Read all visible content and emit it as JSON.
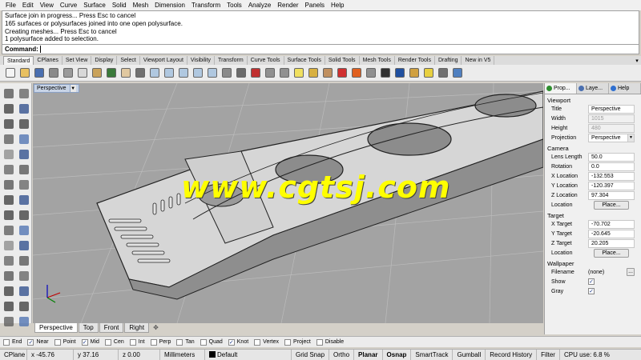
{
  "menu": [
    "File",
    "Edit",
    "View",
    "Curve",
    "Surface",
    "Solid",
    "Mesh",
    "Dimension",
    "Transform",
    "Tools",
    "Analyze",
    "Render",
    "Panels",
    "Help"
  ],
  "history": [
    "Surface join in progress... Press Esc to cancel",
    "165 surfaces or polysurfaces joined into one open polysurface.",
    "Creating meshes... Press Esc to cancel",
    "1 polysurface added to selection."
  ],
  "command": {
    "label": "Command:"
  },
  "toolbar_tabs": [
    "Standard",
    "CPlanes",
    "Set View",
    "Display",
    "Select",
    "Viewport Layout",
    "Visibility",
    "Transform",
    "Curve Tools",
    "Surface Tools",
    "Solid Tools",
    "Mesh Tools",
    "Render Tools",
    "Drafting",
    "New in V5"
  ],
  "toolbar_icons": [
    {
      "name": "new-file-icon",
      "color": "#f4f4f4"
    },
    {
      "name": "open-folder-icon",
      "color": "#e8c060"
    },
    {
      "name": "save-icon",
      "color": "#4a6fb0"
    },
    {
      "name": "print-icon",
      "color": "#8a8a8a"
    },
    {
      "name": "cut-icon",
      "color": "#9a9a9a"
    },
    {
      "name": "copy-icon",
      "color": "#d8d8d8"
    },
    {
      "name": "paste-icon",
      "color": "#c9a25a"
    },
    {
      "name": "undo-icon",
      "color": "#3a7a3a"
    },
    {
      "name": "pan-hand-icon",
      "color": "#e0c8a0"
    },
    {
      "name": "rotate-view-icon",
      "color": "#707070"
    },
    {
      "name": "zoom-icon",
      "color": "#b0c8e0"
    },
    {
      "name": "zoom-window-icon",
      "color": "#b0c8e0"
    },
    {
      "name": "zoom-extents-icon",
      "color": "#b0c8e0"
    },
    {
      "name": "zoom-selected-icon",
      "color": "#b0c8e0"
    },
    {
      "name": "zoom-dynamic-icon",
      "color": "#b0c8e0"
    },
    {
      "name": "select-icon",
      "color": "#8a8a8a"
    },
    {
      "name": "four-viewports-icon",
      "color": "#6a6a6a"
    },
    {
      "name": "car-icon",
      "color": "#c03030"
    },
    {
      "name": "move-icon",
      "color": "#909090"
    },
    {
      "name": "copy-object-icon",
      "color": "#909090"
    },
    {
      "name": "bulb-icon",
      "color": "#f0e060"
    },
    {
      "name": "lock-icon",
      "color": "#d8b040"
    },
    {
      "name": "layer-icon",
      "color": "#c09060"
    },
    {
      "name": "properties-icon",
      "color": "#d03030"
    },
    {
      "name": "color-wheel-icon",
      "color": "#e06020"
    },
    {
      "name": "sphere-gray-icon",
      "color": "#909090"
    },
    {
      "name": "sphere-dark-icon",
      "color": "#303030"
    },
    {
      "name": "sphere-blue-icon",
      "color": "#2050a0"
    },
    {
      "name": "render-teapot-icon",
      "color": "#d0a040"
    },
    {
      "name": "light-bulb-icon",
      "color": "#e8d040"
    },
    {
      "name": "options-icon",
      "color": "#707070"
    },
    {
      "name": "help-icon",
      "color": "#5080c0"
    }
  ],
  "left_tools": [
    "select-arrow-icon",
    "point-icon",
    "polyline-icon",
    "curve-icon",
    "circle-icon",
    "arc-icon",
    "ellipse-icon",
    "rectangle-icon",
    "polygon-icon",
    "freeform-icon",
    "fillet-curve-icon",
    "offset-icon",
    "surface-icon",
    "extrude-icon",
    "box-icon",
    "sphere-icon",
    "cylinder-icon",
    "solid-edit-icon",
    "mesh-icon",
    "split-icon",
    "boolean-icon",
    "trim-icon",
    "join-icon",
    "explode-icon",
    "group-icon",
    "array-icon",
    "dimension-icon",
    "text-icon",
    "orient-icon",
    "scale-icon",
    "analyze-icon",
    "render-icon"
  ],
  "viewport": {
    "name": "Perspective",
    "watermark": "www.cgtsj.com"
  },
  "viewport_tabs": [
    "Perspective",
    "Top",
    "Front",
    "Right"
  ],
  "panel": {
    "tabs": [
      {
        "label": "Prop...",
        "color": "#2f8f2f"
      },
      {
        "label": "Laye...",
        "color": "#4a6fb0"
      },
      {
        "label": "Help",
        "color": "#2f6fd0"
      }
    ],
    "viewport": {
      "heading": "Viewport",
      "title_label": "Title",
      "title": "Perspective",
      "width_label": "Width",
      "width": "1015",
      "height_label": "Height",
      "height": "480",
      "projection_label": "Projection",
      "projection": "Perspective"
    },
    "camera": {
      "heading": "Camera",
      "lens_label": "Lens Length",
      "lens": "50.0",
      "rotation_label": "Rotation",
      "rotation": "0.0",
      "x_label": "X Location",
      "x": "-132.553",
      "y_label": "Y Location",
      "y": "-120.397",
      "z_label": "Z Location",
      "z": "97.304",
      "location_label": "Location",
      "place": "Place..."
    },
    "target": {
      "heading": "Target",
      "x_label": "X Target",
      "x": "-70.702",
      "y_label": "Y Target",
      "y": "-20.645",
      "z_label": "Z Target",
      "z": "20.205",
      "location_label": "Location",
      "place": "Place..."
    },
    "wallpaper": {
      "heading": "Wallpaper",
      "filename_label": "Filename",
      "filename": "(none)",
      "browse": "...",
      "show_label": "Show",
      "gray_label": "Gray"
    }
  },
  "osnaps": [
    {
      "label": "End",
      "checked": false
    },
    {
      "label": "Near",
      "checked": true
    },
    {
      "label": "Point",
      "checked": false
    },
    {
      "label": "Mid",
      "checked": true
    },
    {
      "label": "Cen",
      "checked": false
    },
    {
      "label": "Int",
      "checked": false
    },
    {
      "label": "Perp",
      "checked": false
    },
    {
      "label": "Tan",
      "checked": false
    },
    {
      "label": "Quad",
      "checked": false
    },
    {
      "label": "Knot",
      "checked": true
    },
    {
      "label": "Vertex",
      "checked": false
    },
    {
      "label": "Project",
      "checked": false
    },
    {
      "label": "Disable",
      "checked": false
    }
  ],
  "status": {
    "cplane": "CPlane",
    "x": "x -45.76",
    "y": "y 37.16",
    "z": "z 0.00",
    "units": "Millimeters",
    "layer": "Default",
    "grid_snap": "Grid Snap",
    "ortho": "Ortho",
    "planar": "Planar",
    "osnap": "Osnap",
    "smarttrack": "SmartTrack",
    "gumball": "Gumball",
    "record_history": "Record History",
    "filter": "Filter",
    "cpu": "CPU use: 6.8 %"
  }
}
